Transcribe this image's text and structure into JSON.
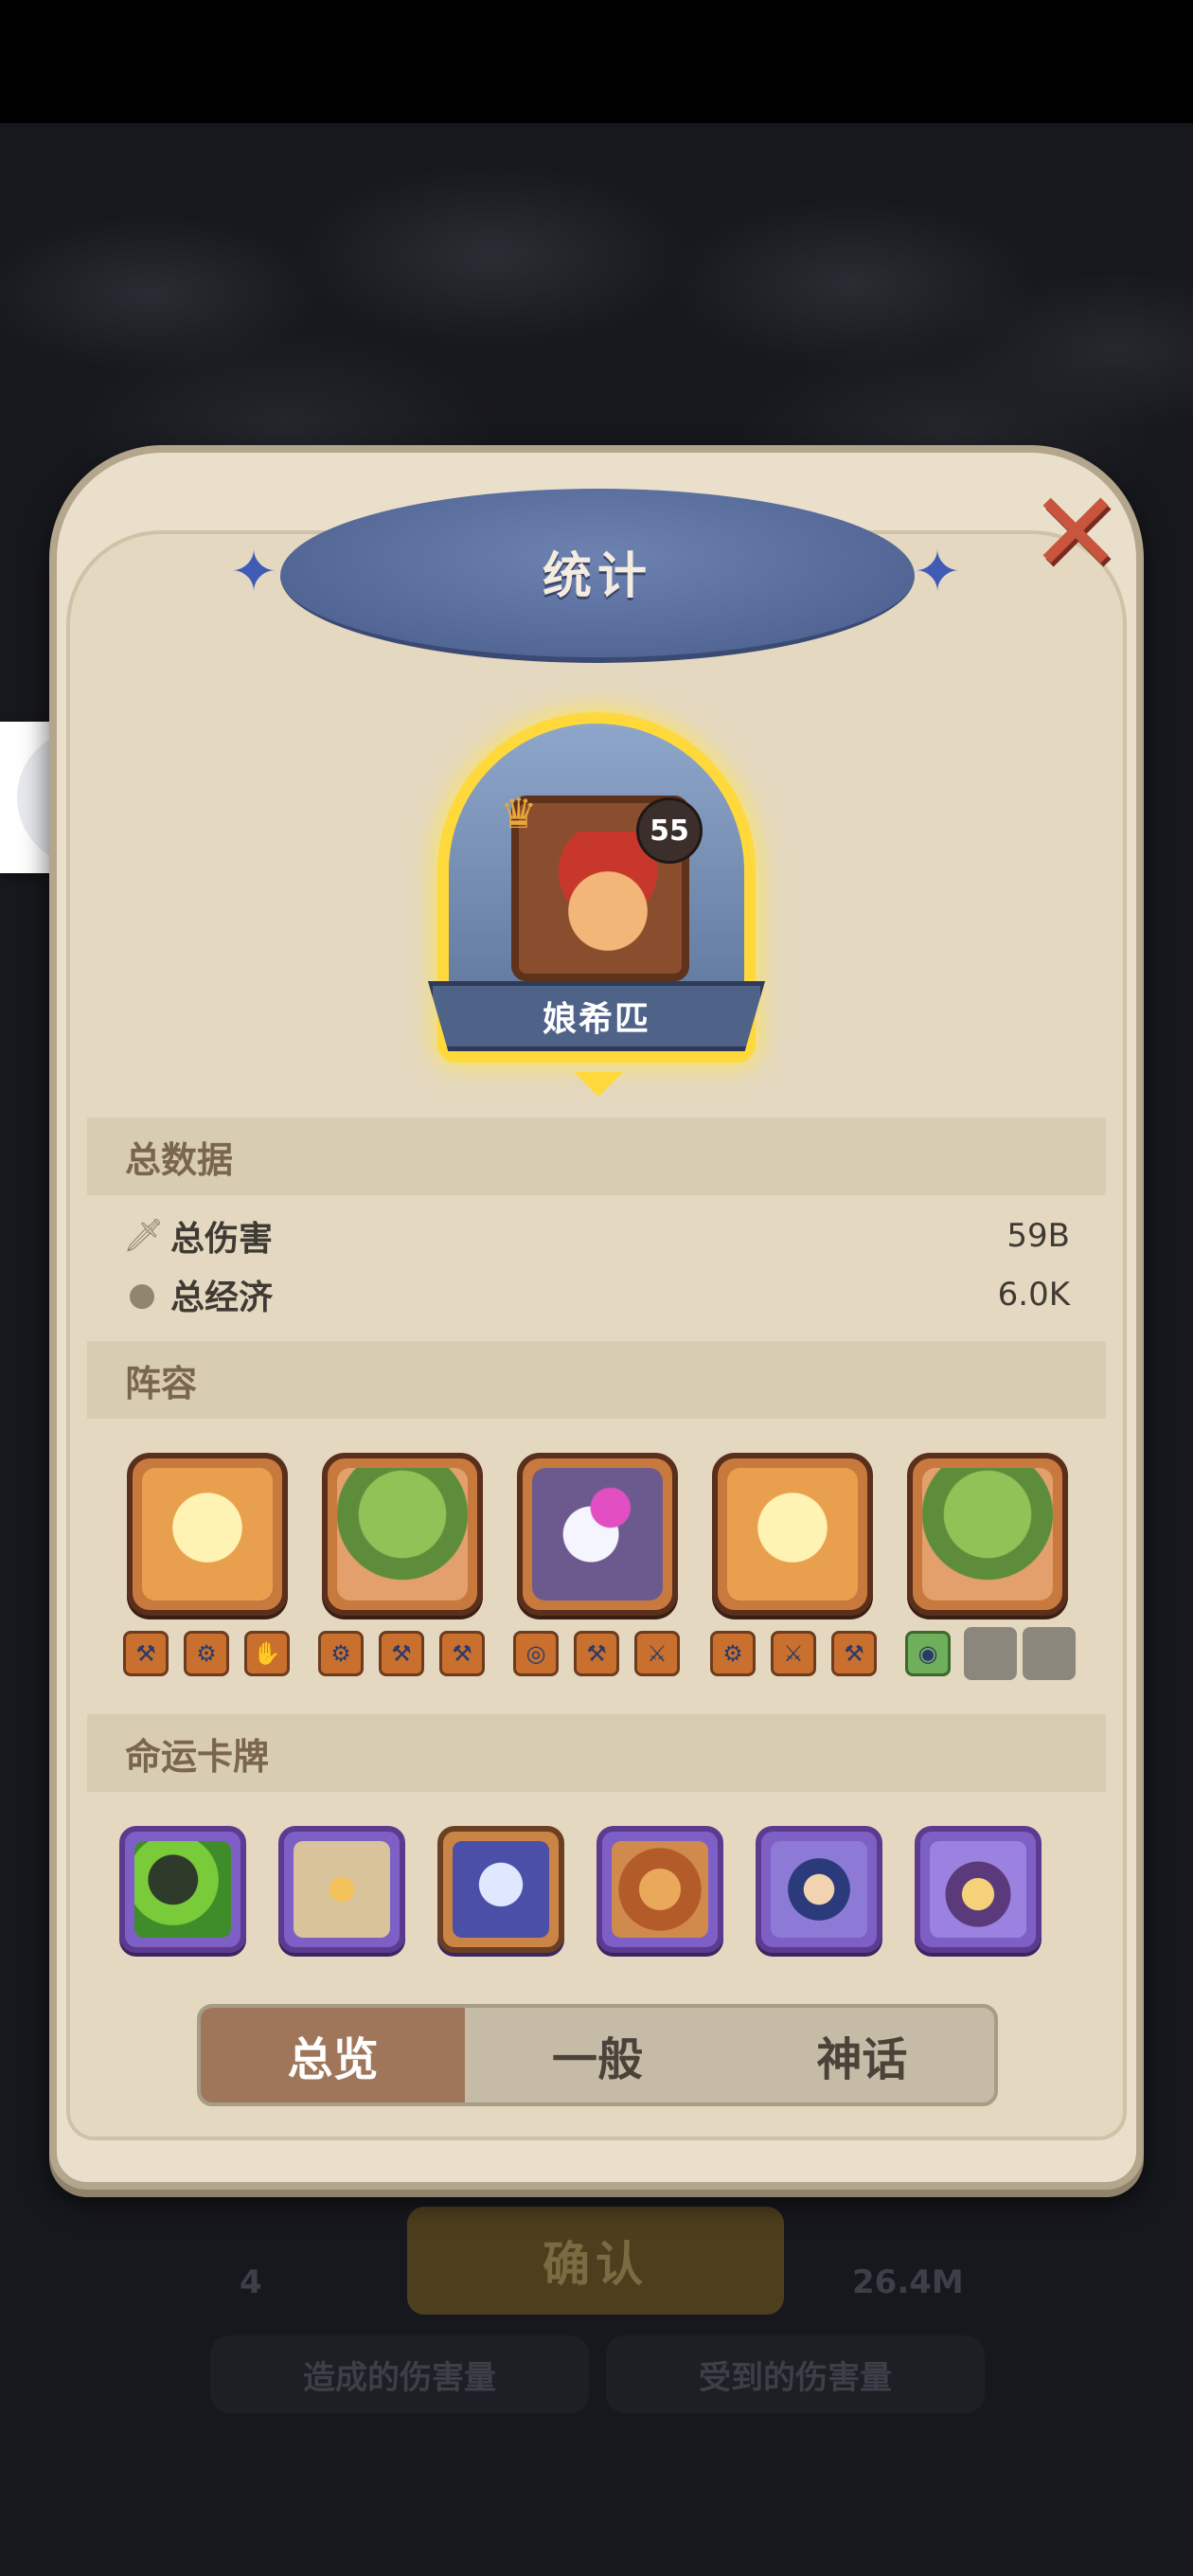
{
  "dialog": {
    "title": "统计",
    "close_icon": "close-x-icon"
  },
  "hero": {
    "name": "娘希匹",
    "level": "55"
  },
  "totals": {
    "header": "总数据",
    "rows": [
      {
        "label": "总伤害",
        "value": "59B",
        "icon": "sword-icon"
      },
      {
        "label": "总经济",
        "value": "6.0K",
        "icon": "piggy-bank-icon"
      }
    ]
  },
  "lineup": {
    "header": "阵容",
    "units": [
      {
        "icon": "lightning-hero-icon"
      },
      {
        "icon": "tree-hero-icon"
      },
      {
        "icon": "witch-hero-icon"
      },
      {
        "icon": "lightning-hero-icon"
      },
      {
        "icon": "tree-hero-icon"
      }
    ]
  },
  "fate_cards": {
    "header": "命运卡牌",
    "cards": [
      {
        "icon": "toucan-card-icon",
        "rarity": "mythic"
      },
      {
        "icon": "chest-card-icon",
        "rarity": "mythic"
      },
      {
        "icon": "ice-tree-card-icon",
        "rarity": "rare"
      },
      {
        "icon": "lion-card-icon",
        "rarity": "mythic"
      },
      {
        "icon": "fox-card-icon",
        "rarity": "mythic"
      },
      {
        "icon": "owl-card-icon",
        "rarity": "mythic"
      }
    ]
  },
  "tabs": [
    {
      "label": "总览",
      "active": true
    },
    {
      "label": "一般",
      "active": false
    },
    {
      "label": "神话",
      "active": false
    }
  ],
  "background": {
    "confirm_label": "确认",
    "row_value": "26.4M",
    "row_rank": "4",
    "tab_dealt": "造成的伤害量",
    "tab_received": "受到的伤害量"
  },
  "colors": {
    "title_oval": "#536796",
    "highlight_gold": "#ffd93b",
    "active_tab": "#a0765a",
    "close_red": "#c9553e"
  }
}
